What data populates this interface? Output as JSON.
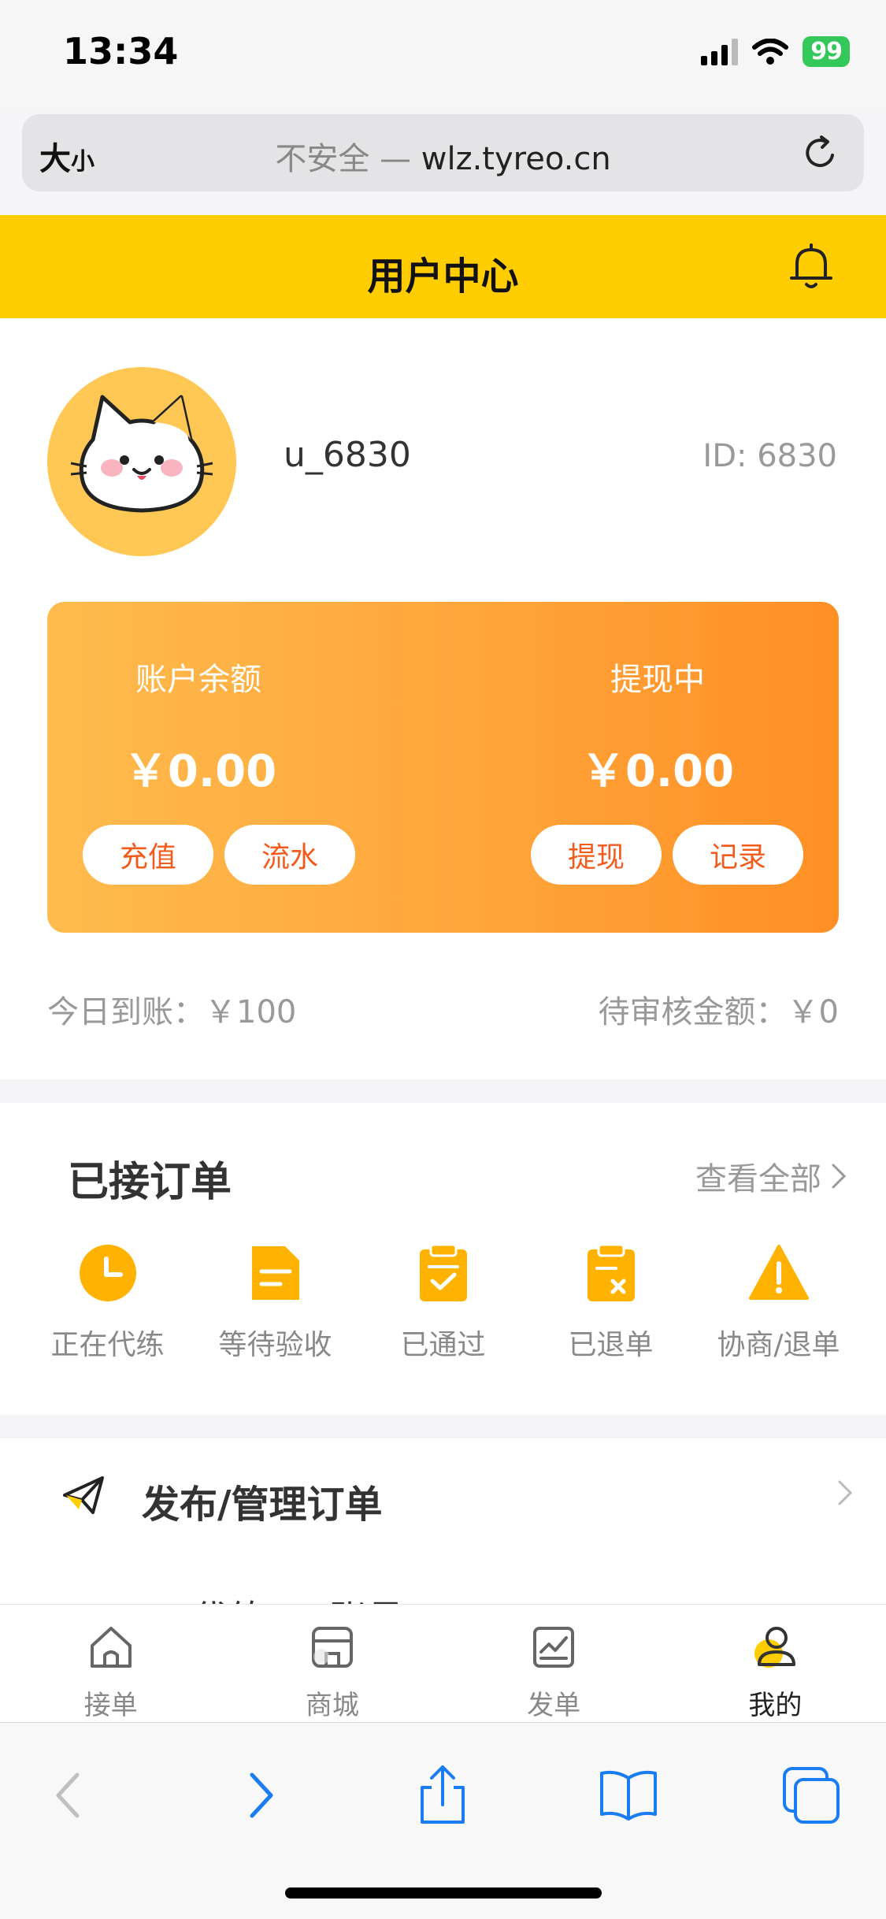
{
  "status_bar": {
    "time": "13:34",
    "battery": "99"
  },
  "browser": {
    "text_size_big": "大",
    "text_size_small": "小",
    "insecure_label": "不安全 —",
    "domain": "wlz.tyreo.cn"
  },
  "header": {
    "title": "用户中心"
  },
  "profile": {
    "username": "u_6830",
    "id_label": "ID: 6830"
  },
  "balance_card": {
    "balance_label": "账户余额",
    "balance_value": "￥0.00",
    "withdrawing_label": "提现中",
    "withdrawing_value": "￥0.00",
    "recharge_btn": "充值",
    "flow_btn": "流水",
    "withdraw_btn": "提现",
    "record_btn": "记录"
  },
  "summary": {
    "today_label": "今日到账：",
    "today_value": "￥100",
    "pending_label": "待审核金额：",
    "pending_value": "￥0"
  },
  "orders": {
    "title": "已接订单",
    "view_all": "查看全部",
    "items": [
      {
        "label": "正在代练",
        "icon": "clock-icon"
      },
      {
        "label": "等待验收",
        "icon": "document-icon"
      },
      {
        "label": "已通过",
        "icon": "clipboard-check-icon"
      },
      {
        "label": "已退单",
        "icon": "clipboard-x-icon"
      },
      {
        "label": "协商/退单",
        "icon": "warning-icon"
      }
    ]
  },
  "manage": {
    "label": "发布/管理订单",
    "partial_next": "… 代练 … 账号"
  },
  "tabs": [
    {
      "label": "接单",
      "icon": "home-icon"
    },
    {
      "label": "商城",
      "icon": "store-icon"
    },
    {
      "label": "发单",
      "icon": "chart-icon"
    },
    {
      "label": "我的",
      "icon": "user-icon"
    }
  ],
  "colors": {
    "brand_yellow": "#ffcd00",
    "card_orange": "#ffa53a",
    "accent_red": "#f25b1c"
  }
}
